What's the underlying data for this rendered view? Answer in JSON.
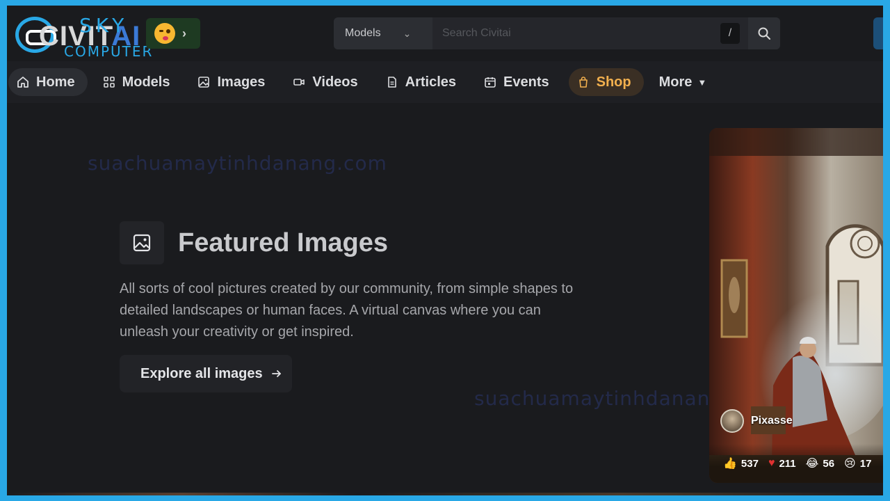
{
  "header": {
    "logo_main": "CIVIT",
    "logo_ai": "AI",
    "watermark_top": "SKY",
    "watermark_bottom": "COMPUTER",
    "search": {
      "category": "Models",
      "placeholder": "Search Civitai",
      "shortcut_key": "/"
    }
  },
  "nav": {
    "items": [
      {
        "label": "Home",
        "icon": "home-icon"
      },
      {
        "label": "Models",
        "icon": "grid-icon"
      },
      {
        "label": "Images",
        "icon": "image-icon"
      },
      {
        "label": "Videos",
        "icon": "video-icon"
      },
      {
        "label": "Articles",
        "icon": "document-icon"
      },
      {
        "label": "Events",
        "icon": "calendar-icon"
      },
      {
        "label": "Shop",
        "icon": "shopping-bag-icon"
      },
      {
        "label": "More",
        "icon": "caret-down-icon"
      }
    ]
  },
  "main": {
    "watermark_1": "suachuamaytinhdanang.com",
    "watermark_2": "suachuamaytinhdanang.com",
    "title": "Featured Images",
    "description": "All sorts of cool pictures created by our community, from simple shapes to detailed landscapes or human faces. A virtual canvas where you can unleash your creativity or get inspired.",
    "cta_label": "Explore all images"
  },
  "card": {
    "username": "Pixasse",
    "reactions": [
      {
        "icon": "thumbs-up-icon",
        "count": "537"
      },
      {
        "icon": "heart-icon",
        "count": "211"
      },
      {
        "icon": "laugh-icon",
        "count": "56"
      },
      {
        "icon": "sad-icon",
        "count": "17"
      }
    ]
  },
  "colors": {
    "background": "#1a1b1e",
    "frame_border": "#29a8e6",
    "shop_accent": "#f2b04e",
    "emoji_bg": "#1e3a22"
  }
}
